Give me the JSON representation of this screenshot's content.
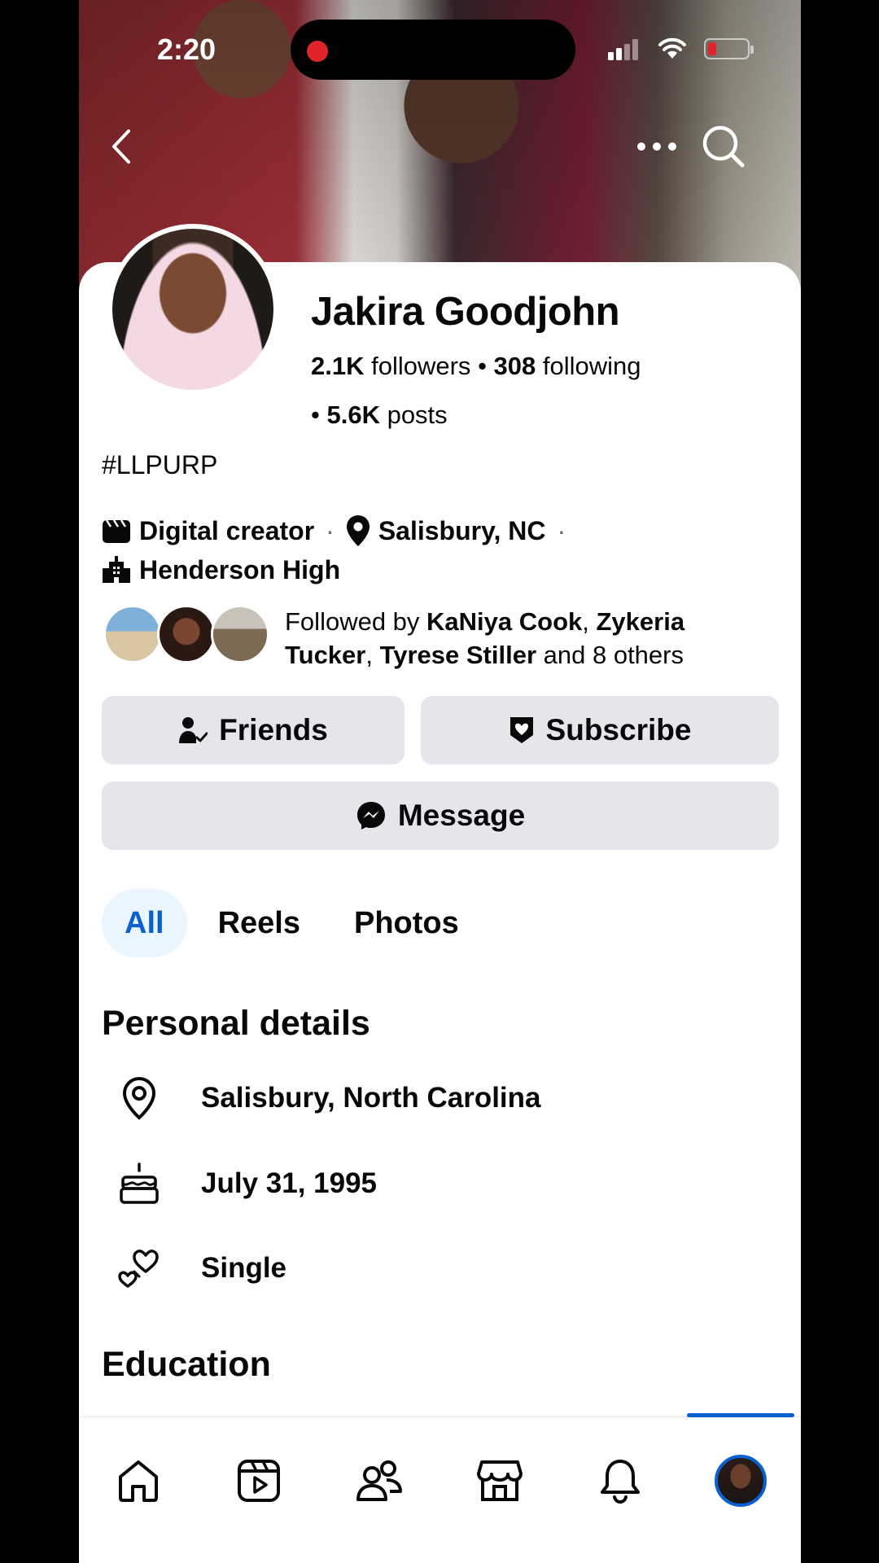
{
  "status_bar": {
    "time": "2:20"
  },
  "profile": {
    "name": "Jakira Goodjohn",
    "followers_count": "2.1K",
    "followers_label": "followers",
    "following_count": "308",
    "following_label": "following",
    "posts_count": "5.6K",
    "posts_label": "posts",
    "bio": "#LLPURP",
    "category": "Digital creator",
    "location": "Salisbury, NC",
    "school": "Henderson High"
  },
  "mutual": {
    "prefix": "Followed by ",
    "name1": "KaNiya Cook",
    "name2": "Zykeria Tucker",
    "name3": "Tyrese Stiller",
    "suffix": "and 8 others"
  },
  "buttons": {
    "friends": "Friends",
    "subscribe": "Subscribe",
    "message": "Message"
  },
  "tabs": [
    {
      "label": "All",
      "active": true
    },
    {
      "label": "Reels",
      "active": false
    },
    {
      "label": "Photos",
      "active": false
    }
  ],
  "personal_details": {
    "heading": "Personal details",
    "location": "Salisbury, North Carolina",
    "birthday": "July 31, 1995",
    "relationship": "Single"
  },
  "education": {
    "heading": "Education"
  },
  "colors": {
    "accent": "#0a5fd1",
    "button_bg": "#e4e6eb",
    "tab_active_bg": "#ebf5ff"
  }
}
